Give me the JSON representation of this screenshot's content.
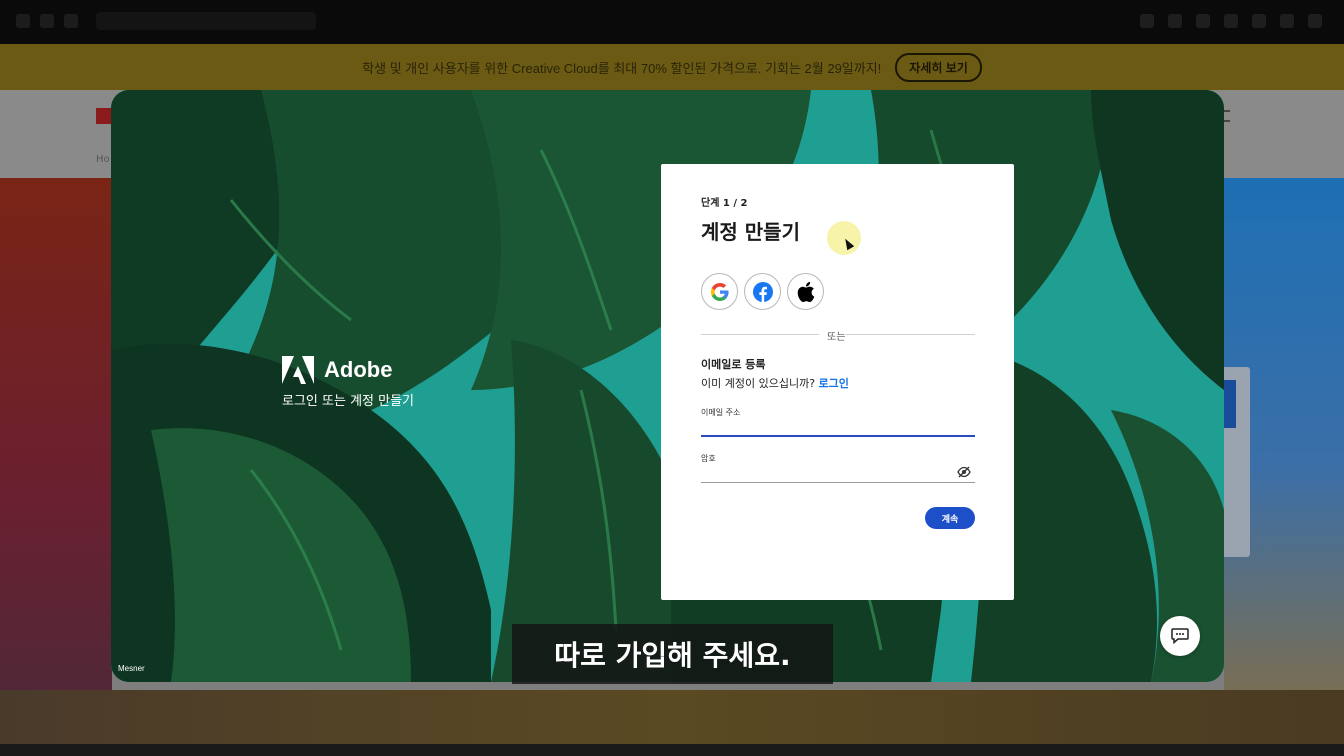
{
  "promo": {
    "text": "학생 및 개인 사용자를 위한 Creative Cloud를 최대 70% 할인된 가격으로. 기회는 2월 29일까지!",
    "button_label": "자세히 보기"
  },
  "site": {
    "breadcrumb": "Ho"
  },
  "brand": {
    "name": "Adobe",
    "tagline": "로그인 또는 계정 만들기",
    "photo_credit": "Mesner"
  },
  "modal": {
    "step": "단계 1 / 2",
    "title": "계정 만들기",
    "social": [
      {
        "icon": "google-icon"
      },
      {
        "icon": "facebook-icon"
      },
      {
        "icon": "apple-icon"
      }
    ],
    "divider": "또는",
    "email_heading": "이메일로 등록",
    "have_account_text": "이미 계정이 있으십니까?",
    "login_link": "로그인",
    "email_label": "이메일 주소",
    "email_value": "",
    "password_label": "암호",
    "password_value": "",
    "continue_label": "계속"
  },
  "caption": "따로 가입해 주세요.",
  "colors": {
    "accent": "#1d4fc9",
    "link": "#1473e6",
    "leaf_bg": "#1e9c8f",
    "promo_bg": "#6b5a14"
  }
}
